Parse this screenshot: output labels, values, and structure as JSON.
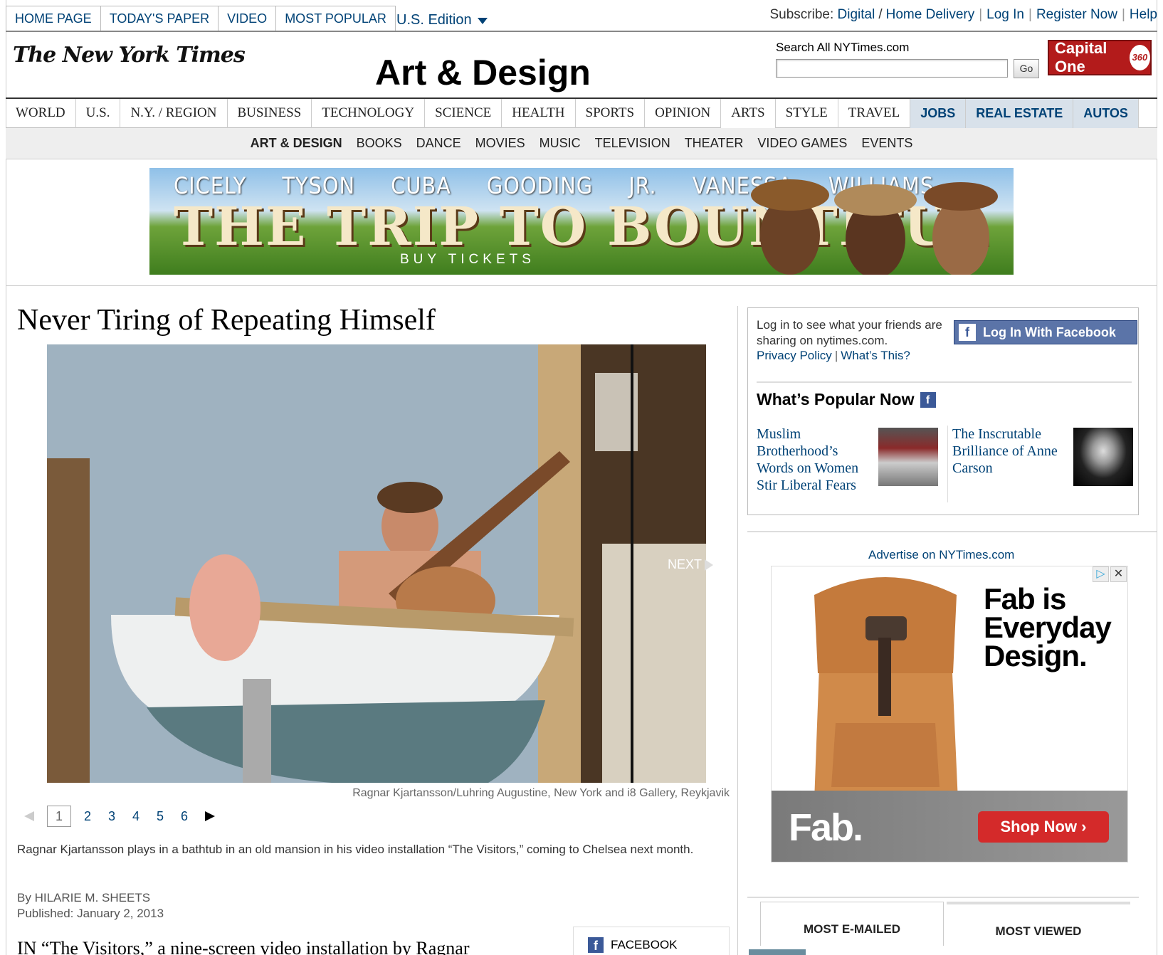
{
  "top_nav": {
    "items": [
      "HOME PAGE",
      "TODAY'S PAPER",
      "VIDEO",
      "MOST POPULAR"
    ],
    "edition": "U.S. Edition"
  },
  "util_nav": {
    "subscribe_label": "Subscribe:",
    "digital": "Digital",
    "home_delivery": "Home Delivery",
    "log_in": "Log In",
    "register": "Register Now",
    "help": "Help"
  },
  "masthead": {
    "logo": "The New York Times",
    "section_title": "Art & Design",
    "search_label": "Search All NYTimes.com",
    "search_placeholder": "",
    "search_button": "Go",
    "sponsor": "Capital One",
    "sponsor_badge": "360"
  },
  "section_nav": {
    "items": [
      "WORLD",
      "U.S.",
      "N.Y. / REGION",
      "BUSINESS",
      "TECHNOLOGY",
      "SCIENCE",
      "HEALTH",
      "SPORTS",
      "OPINION",
      "ARTS",
      "STYLE",
      "TRAVEL"
    ],
    "business_items": [
      "JOBS",
      "REAL ESTATE",
      "AUTOS"
    ]
  },
  "sub_nav": {
    "items": [
      "ART & DESIGN",
      "BOOKS",
      "DANCE",
      "MOVIES",
      "MUSIC",
      "TELEVISION",
      "THEATER",
      "VIDEO GAMES",
      "EVENTS"
    ]
  },
  "banner_ad": {
    "names": "CICELY TYSON  CUBA GOODING JR.  VANESSA WILLIAMS",
    "title": "THE TRIP TO BOUNTIFUL",
    "cta": "BUY TICKETS"
  },
  "article": {
    "headline": "Never Tiring of Repeating Himself",
    "next_label": "NEXT",
    "photo_credit": "Ragnar Kjartansson/Luhring Augustine, New York and i8 Gallery, Reykjavik",
    "pages": [
      "1",
      "2",
      "3",
      "4",
      "5",
      "6"
    ],
    "caption": "Ragnar Kjartansson plays in a bathtub in an old mansion in his video installation “The Visitors,” coming to Chelsea next month.",
    "byline_prefix": "By",
    "author": "HILARIE M. SHEETS",
    "published": "Published: January 2, 2013",
    "lede": "IN “The Visitors,” a nine-screen video installation by Ragnar",
    "share_facebook": "FACEBOOK"
  },
  "sidebar": {
    "fb_text": "Log in to see what your friends are sharing on nytimes.com.",
    "privacy_policy": "Privacy Policy",
    "whats_this": "What’s This?",
    "fb_login": "Log In With Facebook",
    "popular_title": "What’s Popular Now",
    "popular": [
      {
        "title": "Muslim Brotherhood’s Words on Women Stir Liberal Fears"
      },
      {
        "title": "The Inscrutable Brilliance of Anne Carson"
      }
    ],
    "advertise": "Advertise on NYTimes.com",
    "fab_ad": {
      "headline": "Fab is Everyday Design.",
      "logo": "Fab.",
      "cta": "Shop Now"
    },
    "tabs": [
      "MOST E-MAILED",
      "MOST VIEWED"
    ]
  }
}
